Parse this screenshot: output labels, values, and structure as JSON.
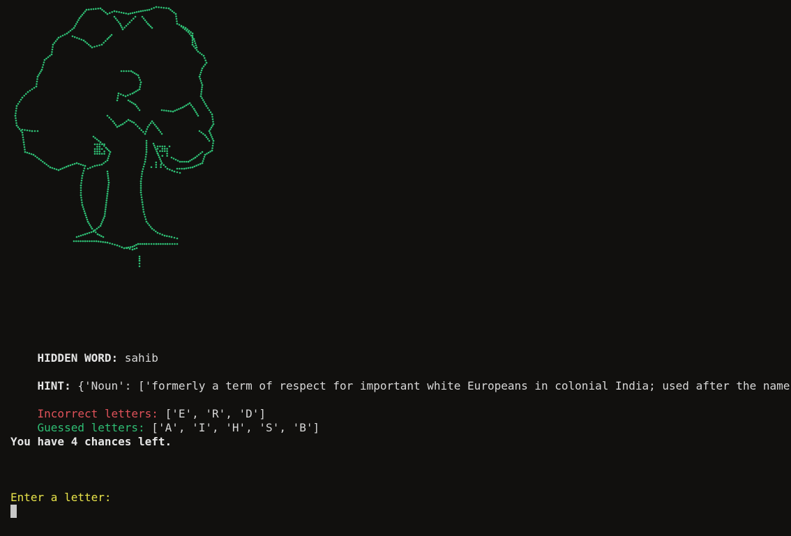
{
  "art": {
    "name": "tree",
    "color": "#2fbe74"
  },
  "hidden_word": {
    "label": "HIDDEN WORD:",
    "value": "sahib"
  },
  "hint": {
    "label": "HINT:",
    "value": "{'Noun': ['formerly a term of respect for important white Europeans in colonial India; used after the name']}"
  },
  "incorrect": {
    "label": "Incorrect letters:",
    "value": "['E', 'R', 'D']"
  },
  "guessed": {
    "label": "Guessed letters:",
    "value": "['A', 'I', 'H', 'S', 'B']"
  },
  "chances": {
    "text": "You have 4 chances left."
  },
  "prompt": {
    "text": "Enter a letter:"
  },
  "colors": {
    "background": "#11100e",
    "incorrect": "#e0525a",
    "guessed": "#2fbe74",
    "prompt": "#e8e34a"
  }
}
